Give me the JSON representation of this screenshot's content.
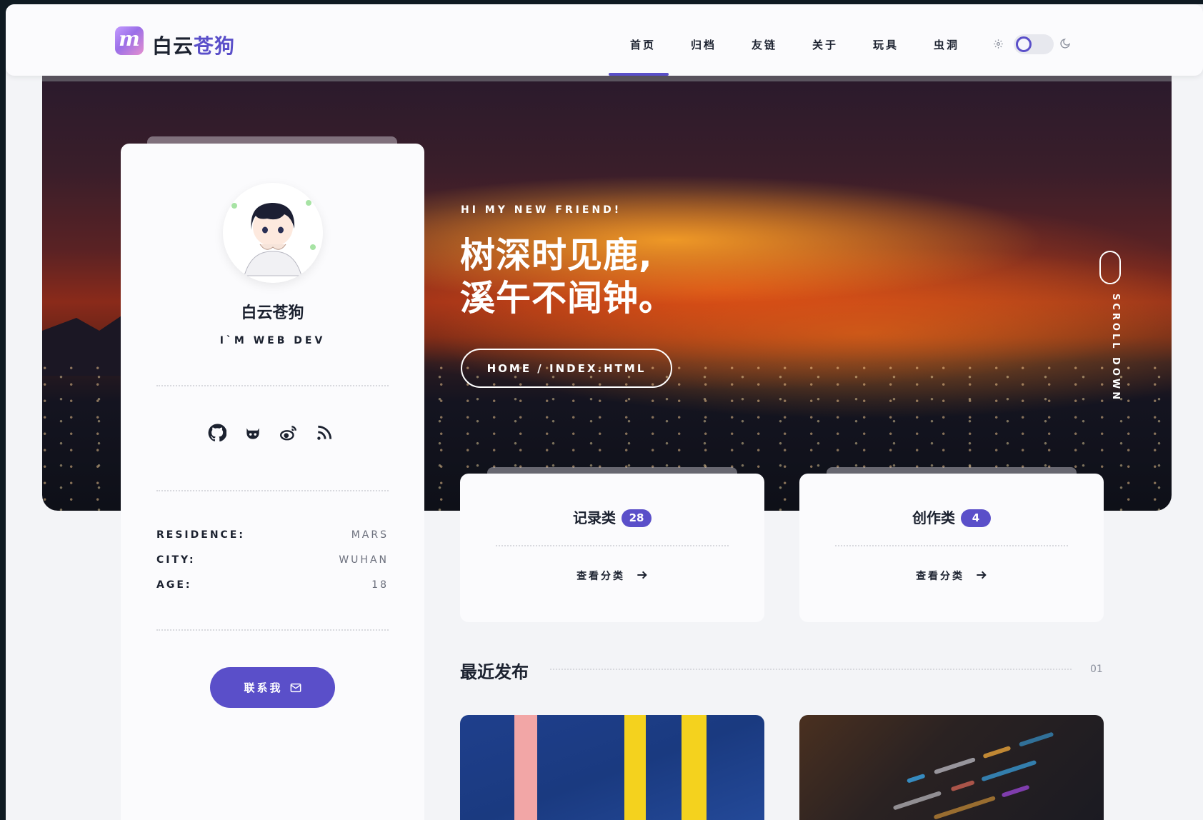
{
  "header": {
    "logo_letter": "m",
    "title_a": "白云",
    "title_b": "苍狗",
    "nav": [
      "首页",
      "归档",
      "友链",
      "关于",
      "玩具",
      "虫洞"
    ],
    "active_index": 0,
    "theme_toggle": {
      "left_icon": "gear-icon",
      "right_icon": "moon-icon",
      "state": "light"
    }
  },
  "hero": {
    "greeting": "HI MY NEW FRIEND!",
    "poem_line1": "树深时见鹿,",
    "poem_line2": "溪午不闻钟。",
    "breadcrumb": "HOME / INDEX.HTML",
    "scroll_label": "SCROLL DOWN"
  },
  "profile": {
    "name": "白云苍狗",
    "role": "I`M WEB DEV",
    "social": [
      "github-icon",
      "octocat-icon",
      "weibo-icon",
      "rss-icon"
    ],
    "info": [
      {
        "key": "RESIDENCE:",
        "value": "MARS"
      },
      {
        "key": "CITY:",
        "value": "WUHAN"
      },
      {
        "key": "AGE:",
        "value": "18"
      }
    ],
    "contact_label": "联系我"
  },
  "categories": [
    {
      "title": "记录类",
      "count": "28",
      "link": "查看分类"
    },
    {
      "title": "创作类",
      "count": "4",
      "link": "查看分类"
    }
  ],
  "recent": {
    "title": "最近发布",
    "page": "01"
  },
  "colors": {
    "accent": "#5a4fc9",
    "text": "#1c2230",
    "page_bg": "#f3f4f7",
    "card_bg": "#fbfbfd"
  }
}
